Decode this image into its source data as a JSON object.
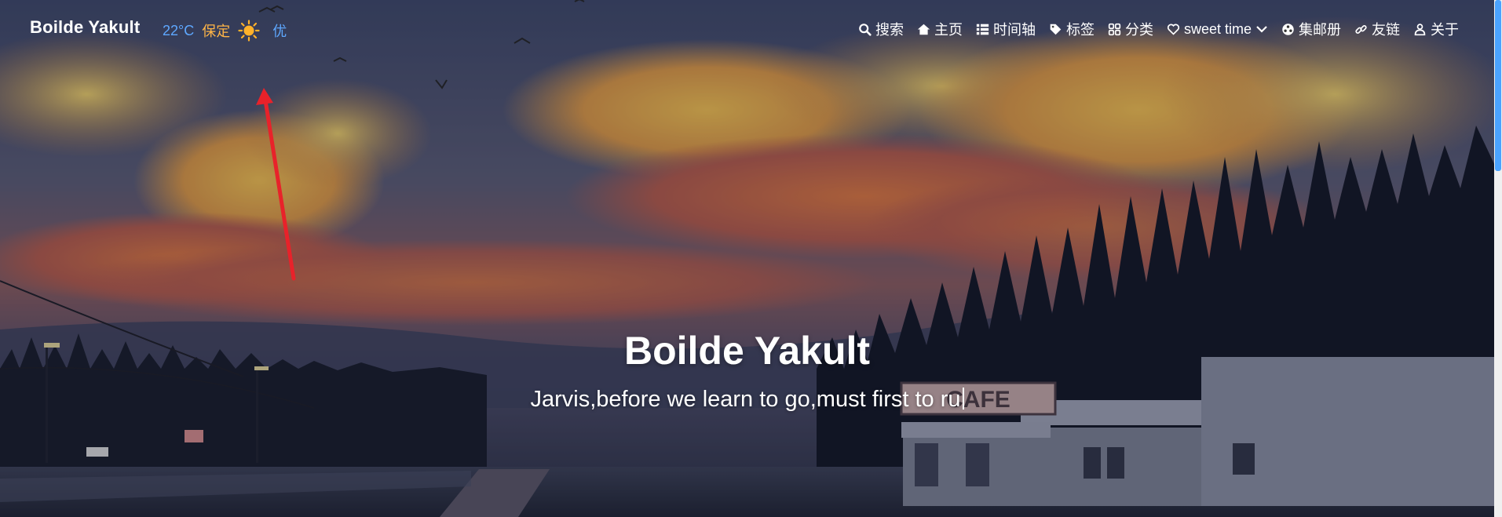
{
  "site": {
    "brand": "Boilde Yakult"
  },
  "weather": {
    "temperature": "22°C",
    "city": "保定",
    "icon": "sun-icon",
    "air_quality": "优",
    "temp_color": "#5ea8ff",
    "city_color": "#ffb547"
  },
  "menu": {
    "items": [
      {
        "label": "搜索",
        "icon": "search-icon"
      },
      {
        "label": "主页",
        "icon": "home-icon"
      },
      {
        "label": "时间轴",
        "icon": "timeline-icon"
      },
      {
        "label": "标签",
        "icon": "tag-icon"
      },
      {
        "label": "分类",
        "icon": "category-icon"
      },
      {
        "label": "sweet time",
        "icon": "heart-icon",
        "dropdown": true
      },
      {
        "label": "集邮册",
        "icon": "album-icon"
      },
      {
        "label": "友链",
        "icon": "link-icon"
      },
      {
        "label": "关于",
        "icon": "user-icon"
      }
    ]
  },
  "hero": {
    "title": "Boilde Yakult",
    "subtitle": "Jarvis,before we learn to go,must first to ru"
  },
  "colors": {
    "accent": "#4aa3ff",
    "annotation_arrow": "#e8222a"
  }
}
